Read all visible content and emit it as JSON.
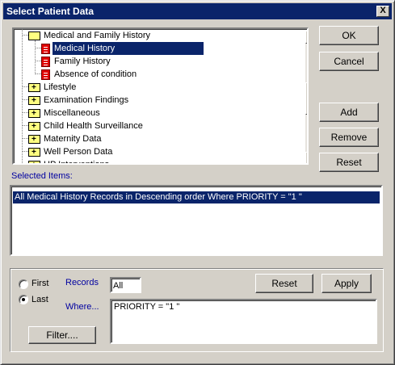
{
  "window": {
    "title": "Select Patient Data",
    "close_glyph": "X"
  },
  "tree": {
    "items": [
      {
        "label": "Medical and Family History",
        "icon": "folder-open-icon",
        "level": 1
      },
      {
        "label": "Medical History",
        "icon": "document-icon",
        "level": 2,
        "selected": true
      },
      {
        "label": "Family History",
        "icon": "document-icon",
        "level": 2
      },
      {
        "label": "Absence of condition",
        "icon": "document-icon",
        "level": 2
      },
      {
        "label": "Lifestyle",
        "icon": "folder-plus-icon",
        "level": 1
      },
      {
        "label": "Examination Findings",
        "icon": "folder-plus-icon",
        "level": 1
      },
      {
        "label": "Miscellaneous",
        "icon": "folder-plus-icon",
        "level": 1
      },
      {
        "label": "Child Health Surveillance",
        "icon": "folder-plus-icon",
        "level": 1
      },
      {
        "label": "Maternity Data",
        "icon": "folder-plus-icon",
        "level": 1
      },
      {
        "label": "Well Person Data",
        "icon": "folder-plus-icon",
        "level": 1
      },
      {
        "label": "HP Interventions",
        "icon": "folder-plus-icon",
        "level": 1
      }
    ]
  },
  "buttons": {
    "ok": "OK",
    "cancel": "Cancel",
    "add": "Add",
    "remove": "Remove",
    "reset": "Reset",
    "reset2": "Reset",
    "apply": "Apply",
    "filter": "Filter...."
  },
  "selected_items": {
    "label": "Selected Items:",
    "rows": [
      "All Medical History Records in Descending order Where PRIORITY = \"1 \""
    ]
  },
  "options": {
    "first_label": "First",
    "last_label": "Last",
    "records_label": "Records",
    "records_value": "All",
    "where_label": "Where...",
    "where_value": "PRIORITY = \"1 \""
  },
  "colors": {
    "selection": "#0a246a",
    "face": "#d4d0c8",
    "label_blue": "#0000a0"
  }
}
